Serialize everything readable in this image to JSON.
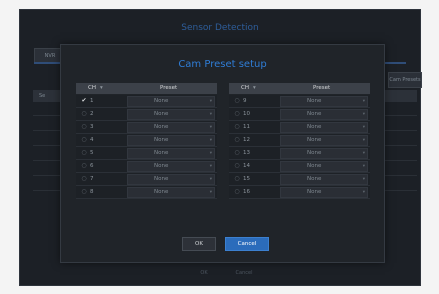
{
  "background": {
    "title": "Sensor Detection",
    "tab": "NVR",
    "top_button": "Cam Presets",
    "header_col": "Se",
    "buttons": {
      "ok": "OK",
      "cancel": "Cancel"
    }
  },
  "modal": {
    "title": "Cam Preset setup",
    "columns": {
      "ch": "CH",
      "preset": "Preset"
    },
    "left_rows": [
      {
        "ch": "1",
        "checked": true,
        "preset": "None"
      },
      {
        "ch": "2",
        "checked": false,
        "preset": "None"
      },
      {
        "ch": "3",
        "checked": false,
        "preset": "None"
      },
      {
        "ch": "4",
        "checked": false,
        "preset": "None"
      },
      {
        "ch": "5",
        "checked": false,
        "preset": "None"
      },
      {
        "ch": "6",
        "checked": false,
        "preset": "None"
      },
      {
        "ch": "7",
        "checked": false,
        "preset": "None"
      },
      {
        "ch": "8",
        "checked": false,
        "preset": "None"
      }
    ],
    "right_rows": [
      {
        "ch": "9",
        "checked": false,
        "preset": "None"
      },
      {
        "ch": "10",
        "checked": false,
        "preset": "None"
      },
      {
        "ch": "11",
        "checked": false,
        "preset": "None"
      },
      {
        "ch": "12",
        "checked": false,
        "preset": "None"
      },
      {
        "ch": "13",
        "checked": false,
        "preset": "None"
      },
      {
        "ch": "14",
        "checked": false,
        "preset": "None"
      },
      {
        "ch": "15",
        "checked": false,
        "preset": "None"
      },
      {
        "ch": "16",
        "checked": false,
        "preset": "None"
      }
    ],
    "ok_label": "OK",
    "cancel_label": "Cancel"
  },
  "colors": {
    "accent": "#2b6cbb",
    "title": "#2f7dd6",
    "panel": "#202429"
  }
}
